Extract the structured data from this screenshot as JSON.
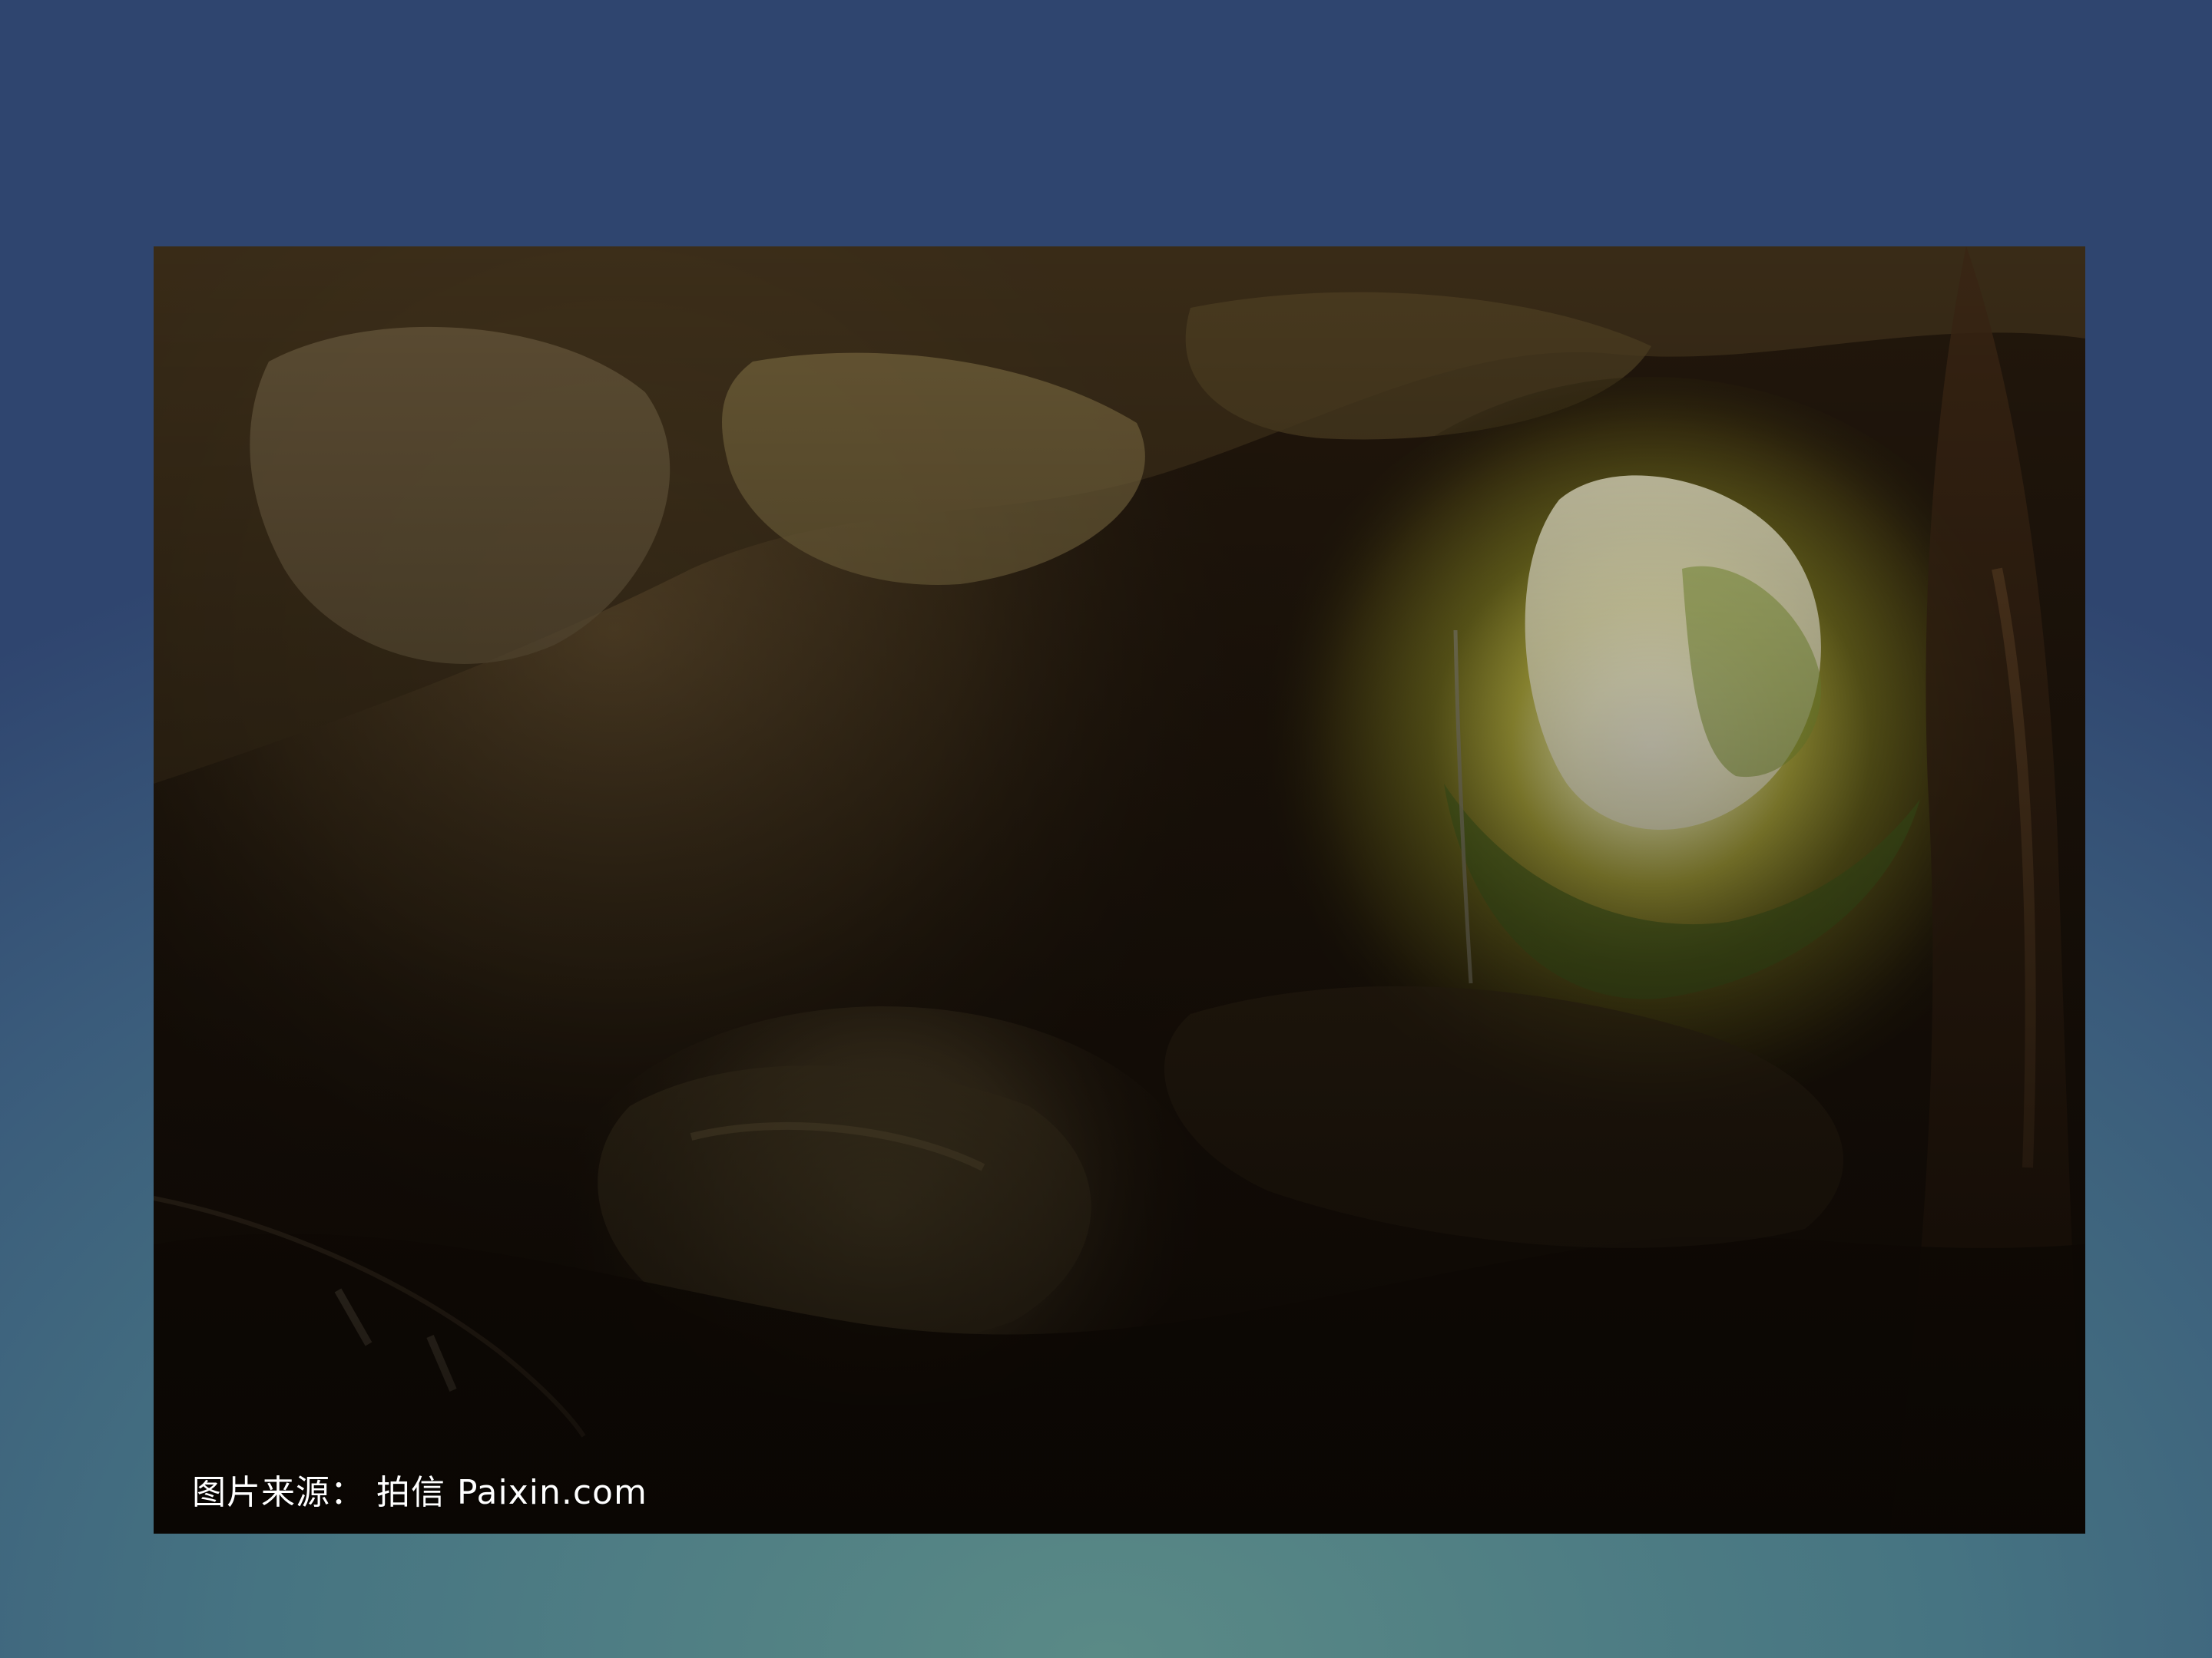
{
  "slide": {
    "photo": {
      "subject": "cave-interior-with-skylight-opening",
      "caption": "图片来源： 拍信 Paixin.com"
    }
  }
}
